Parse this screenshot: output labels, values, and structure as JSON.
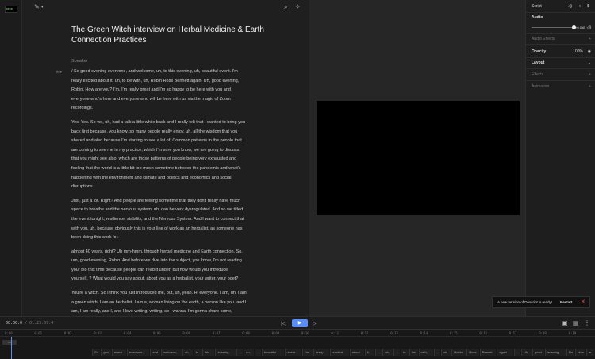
{
  "thumbnail_text": "00:00",
  "editor": {
    "title": "The Green Witch interview on Herbal Medicine & Earth Connection Practices",
    "speaker_label": "Speaker",
    "paragraphs": [
      "/ So good evening everyone, and welcome, uh, to this evening, uh, beautiful event. I'm\nreally excited about it, uh, to be with, uh, Robin Ross Bennett again. Uh, good evening,\nRobin. How are you? I'm, I'm really great and I'm so happy to be here with you and\neveryone who's here and everyone who will be here with us via the magic of Zoom\nrecordings.",
      "Yes. Yes. So we, uh, had a talk a little while back and I really felt that I wanted to bring you\nback first because, you know, so many people really enjoy, uh, all the wisdom that you\nshared and also because I'm starting to see a lot of. Common patterns in the people that\nare coming to see me in my practice, which I'm sure you know, we are going to discuss\nthat you might see also, which are those patterns of people being very exhausted and\nfeeling that the world is a little bit too much sometime between the pandemic and what's\nhappening with the environment and climate and politics and economics and social\ndisruptions.",
      "Just, just a lot. Right? And people are feeling sometime that they don't really have much\nspace to breathe and the nervous system, uh, can be very dysregulated. And so we titled\nthe event tonight, resilience, stability, and the Nervous System. And I want to connect that\nwith you, uh, because obviously this is your line of work as an herbalist, as someone has\nbeen doing this work for.",
      "almost 40 years, right? Uh mm-hmm.  through herbal medicine and Earth connection. So,\num, good evening, Robin. And before we dive into the subject, you know, I'm not reading\nyour bio this time because people can read it under, but how would you introduce\nyourself, ? What would you say about, about you as a herbalist, your writer, your poet?",
      "You're a witch. So I think you just introduced me, but, uh, yeah. Hi everyone. I am, uh, I am\na green witch. I am an herbalist. I am a, woman living on the earth, a person like you. and I\nam, I am really, and I, and I love writing, writing, so I wanna, I'm gonna share some,"
    ]
  },
  "panel": {
    "tab_script": "Script",
    "audio_label": "Audio",
    "volume_value": "+0.0dB",
    "audio_effects_label": "Audio Effects",
    "opacity_label": "Opacity",
    "opacity_value": "100%",
    "layout_label": "Layout",
    "effects_label": "Effects",
    "animation_label": "Animation"
  },
  "toast": {
    "message": "A new version of Descript is ready!",
    "restart_label": "Restart"
  },
  "transport": {
    "current_time": "00:00.0",
    "total_time": "01:23:09.4"
  },
  "timeline": {
    "ticks": [
      "0:00",
      "0:01",
      "0:02",
      "0:03",
      "0:04",
      "0:05",
      "0:06",
      "0:07",
      "0:08",
      "0:09",
      "0:10",
      "0:11",
      "0:12",
      "0:13",
      "0:14",
      "0:15",
      "0:16",
      "0:17",
      "0:18",
      "0:19"
    ],
    "track_label": "—",
    "words": [
      "So",
      "goo",
      "event",
      "everyone,",
      "and",
      "welcome,",
      "uh,",
      "to",
      "this",
      "evening,",
      "…",
      "uh,",
      "…",
      "beautiful",
      "event.",
      "I'm",
      "really",
      "excited",
      "about",
      "it,",
      "…",
      "uh,",
      "…",
      "to",
      "be",
      "with,",
      "…",
      "uh,",
      "Robin",
      "Ross",
      "Bennet",
      "again.",
      "…",
      "Uh,",
      "good",
      "evening,",
      "Ro",
      "How",
      "ar",
      "you"
    ]
  }
}
